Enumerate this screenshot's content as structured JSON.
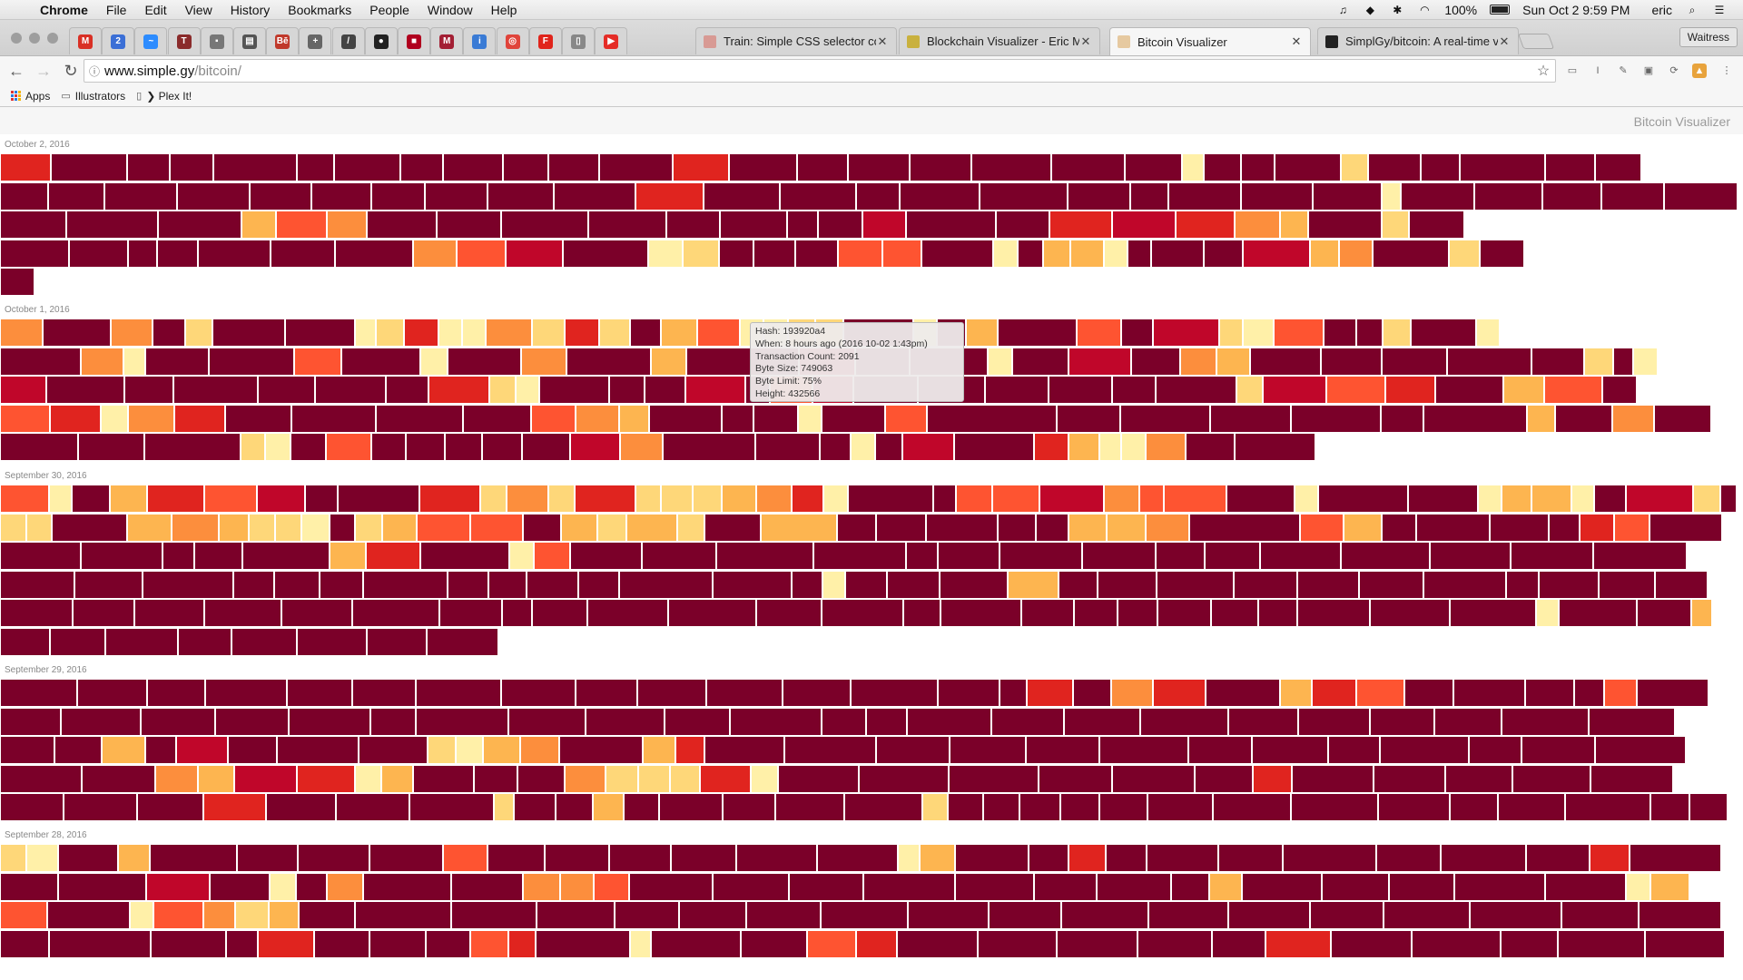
{
  "menubar": {
    "app": "Chrome",
    "items": [
      "File",
      "Edit",
      "View",
      "History",
      "Bookmarks",
      "People",
      "Window",
      "Help"
    ],
    "battery": "100%",
    "clock": "Sun Oct 2  9:59 PM",
    "user": "eric"
  },
  "tabs": {
    "pinned": [
      {
        "icon": "gmail-icon",
        "glyph": "M",
        "color": "#d93025"
      },
      {
        "icon": "calendar-icon",
        "glyph": "2",
        "color": "#3b6fd6"
      },
      {
        "icon": "messenger-icon",
        "glyph": "~",
        "color": "#2d8cff"
      },
      {
        "icon": "news-icon",
        "glyph": "T",
        "color": "#8a2b2b"
      },
      {
        "icon": "app-icon",
        "glyph": "▪",
        "color": "#777777"
      },
      {
        "icon": "reader-icon",
        "glyph": "▤",
        "color": "#555555"
      },
      {
        "icon": "behance-icon",
        "glyph": "Bē",
        "color": "#c0392b"
      },
      {
        "icon": "plus-icon",
        "glyph": "+",
        "color": "#666666"
      },
      {
        "icon": "chart-icon",
        "glyph": "/",
        "color": "#444444"
      },
      {
        "icon": "github-icon",
        "glyph": "●",
        "color": "#222222"
      },
      {
        "icon": "shield-icon",
        "glyph": "■",
        "color": "#b0001e"
      },
      {
        "icon": "mit-icon",
        "glyph": "M",
        "color": "#a31f34"
      },
      {
        "icon": "info-icon",
        "glyph": "i",
        "color": "#3a7bd5"
      },
      {
        "icon": "target-icon",
        "glyph": "◎",
        "color": "#e0443b"
      },
      {
        "icon": "font-icon",
        "glyph": "F",
        "color": "#e0241b"
      },
      {
        "icon": "doc-icon",
        "glyph": "▯",
        "color": "#888888"
      },
      {
        "icon": "youtube-icon",
        "glyph": "▶",
        "color": "#e52d27"
      }
    ],
    "open": [
      {
        "title": "Train: Simple CSS selector cor",
        "favicon": "#d89a94",
        "close": "✕"
      },
      {
        "title": "Blockchain Visualizer - Eric Mi",
        "favicon": "#c9b13e",
        "close": "✕"
      },
      {
        "title": "Bitcoin Visualizer",
        "favicon": "#e6c9a0",
        "close": "✕"
      },
      {
        "title": "SimplGy/bitcoin: A real-time vi",
        "favicon": "#222222",
        "close": "✕"
      }
    ],
    "active_index": 2,
    "profile": "Waitress"
  },
  "toolbar": {
    "url_host": "www.simple.gy",
    "url_path": "/bitcoin/"
  },
  "bookmarks": [
    {
      "label": "Apps",
      "icon": "apps-grid-icon"
    },
    {
      "label": "Illustrators",
      "icon": "folder-icon"
    },
    {
      "label": "❯ Plex It!",
      "icon": "page-icon"
    }
  ],
  "page": {
    "site_title": "Bitcoin Visualizer",
    "colors": {
      "C0": "#7b0029",
      "C1": "#c0062a",
      "C2": "#e0241f",
      "C3": "#fe5431",
      "C4": "#fc8e3d",
      "C5": "#fdb550",
      "C6": "#fed779",
      "C7": "#fff0a8"
    },
    "days": [
      {
        "label": "October 2, 2016",
        "rows": [
          "56:C2,84:C0,47:C0,48:C0,92:C0,41:C0,73:C0,47:C0,66:C0,50:C0,56:C0,81:C0,62:C2,75:C0,56:C0,68:C0,68:C0,88:C0,81:C0,63:C0,24:C7,41:C0,37:C0,73:C0,30:C6,58:C0,43:C0,94:C0,55:C0,51:C0",
          "53:C0,62:C0,80:C0,80:C0,68:C0,66:C0,59:C0,69:C0,73:C0,90:C0,75:C2,84:C0,84:C0,48:C0,88:C0,97:C0,69:C0,42:C0,80:C0,79:C0,76:C0,21:C7,81:C0,75:C0,65:C0,69:C0,81:C0,56:C0,51:C0,80:C0",
          "73:C0,101:C0,92:C0,38:C5,56:C3,44:C4,77:C0,71:C0,96:C0,86:C0,59:C0,74:C0,34:C0,49:C0,48:C1,99:C0,59:C0,69:C2,70:C1,65:C2,50:C4,31:C5,81:C0,30:C6,61:C0",
          "76:C0,65:C0,32:C0,45:C0,80:C0,71:C0,86:C0,48:C4,54:C3,63:C1,94:C0,38:C7,40:C6,38:C0,46:C0,47:C0,49:C3,43:C3,79:C0,27:C7,28:C0,30:C5,37:C5,26:C7,26:C0,58:C0,43:C0,74:C1,32:C5,37:C4,84:C0,34:C6,49:C0",
          "38:C0"
        ]
      },
      {
        "label": "October 1, 2016",
        "rows": [
          "47:C4,75:C0,46:C4,36:C0,30:C6,80:C0,77:C0,23:C7,31:C6,38:C2,26:C7,26:C7,51:C4,36:C6,38:C2,34:C6,34:C0,40:C5,47:C3,26:C7,27:C7,30:C6,31:C6,77:C0,26:C7,32:C0,35:C5,87:C0,49:C3,35:C0,73:C1,26:C6,34:C7,55:C3,36:C0,29:C0,31:C6,72:C0,26:C7",
          "89:C0,47:C4,24:C7,70:C0,94:C0,52:C3,87:C0,30:C7,81:C0,50:C4,93:C0,39:C5,124:C0,62:C1,60:C0,86:C0,27:C7,62:C0,69:C1,54:C0,40:C4,37:C5,78:C0,67:C0,72:C0,93:C0,58:C0,32:C6,22:C0,27:C7",
          "51:C1,86:C0,54:C0,93:C0,63:C0,78:C0,47:C0,67:C2,29:C6,26:C7,77:C0,39:C0,45:C0,66:C1,27:C0,47:C3,45:C1,71:C0,74:C0,70:C0,70:C0,48:C0,89:C0,29:C6,70:C1,65:C3,55:C2,75:C0,45:C5,64:C3,38:C0",
          "55:C3,56:C2,30:C7,51:C4,56:C2,73:C0,93:C0,96:C0,75:C0,49:C3,48:C4,33:C5,80:C0,35:C0,49:C0,26:C7,70:C0,46:C3,143:C0,70:C0,99:C0,89:C0,99:C0,47:C0,114:C0,31:C5,63:C0,46:C4,63:C0,80:C0",
          "86:C0,73:C0,106:C0,27:C6,28:C7,39:C0,50:C3,38:C0,43:C0,41:C0,44:C0,53:C0,55:C1,47:C4,102:C0,71:C0,34:C0,27:C7,30:C0,57:C1,88:C0,38:C2,34:C5,24:C7,27:C7,44:C4,54:C0,89:C0"
        ]
      },
      {
        "label": "September 30, 2016",
        "rows": [
          "54:C3,25:C7,42:C0,41:C5,63:C2,58:C3,53:C1,36:C0,90:C0,67:C2,29:C6,46:C4,29:C6,67:C2,28:C6,35:C6,32:C6,38:C5,39:C4,35:C2,27:C7,94:C0,25:C0,40:C3,52:C3,71:C1,39:C4,27:C3,69:C3,75:C0,26:C7,99:C0,77:C0,26:C7,33:C5,44:C5,25:C7,35:C0,74:C1,30:C6,44:C0,26:C7,29:C4,31:C0,18:C0,58:C0,25:C7",
          "29:C6,28:C6,83:C0,49:C5,52:C4,33:C5,29:C6,29:C6,31:C7,28:C0,30:C6,38:C5,59:C3,58:C3,42:C0,40:C5,32:C6,56:C5,30:C6,62:C0,84:C5,43:C0,55:C0,79:C0,42:C0,36:C0,42:C5,43:C5,48:C4,122:C0,48:C3,42:C5,38:C0,81:C0,65:C0,34:C0,38:C2,39:C3,80:C0",
          "89:C0,90:C0,35:C0,53:C0,96:C0,40:C5,60:C2,98:C0,27:C7,40:C3,79:C0,82:C0,107:C0,102:C0,35:C0,68:C0,91:C0,81:C0,54:C0,61:C0,89:C0,98:C0,89:C0,91:C0,103:C0,87:C0,79:C0,67:C0,79:C0",
          "82:C0,75:C0,100:C0,45:C0,50:C0,48:C0,93:C0,45:C0,42:C0,57:C0,45:C0,103:C0,87:C0,34:C0,25:C7,46:C0,58:C0,75:C0,56:C5,43:C0,65:C0,85:C0,70:C0,68:C0,71:C0,91:C0,36:C0,66:C0,62:C0,58:C0,61:C0,57:C0,57:C0,57:C0,86:C0,93:C0",
          "80:C0,68:C0,77:C0,85:C0,78:C0,96:C0,69:C0,33:C0,61:C0,89:C0,97:C0,72:C0,90:C0,41:C0,89:C0,58:C0,48:C0,44:C0,59:C0,52:C0,43:C0,80:C0,88:C0,95:C0,25:C7,86:C0,60:C0,77:C1,23:C5,46:C0,48:C0,72:C0,70:C0,46:C0,92:C0,76:C0,84:C0,76:C0",
          "55:C0,61:C0,80:C0,59:C0,72:C0,77:C0,66:C0,79:C0"
        ]
      },
      {
        "label": "September 29, 2016",
        "rows": [
          "85:C0,77:C0,64:C0,90:C0,72:C0,70:C0,94:C0,82:C0,68:C0,76:C0,84:C0,75:C0,96:C0,68:C0,30:C0,51:C2,42:C0,46:C4,58:C2,82:C0,35:C5,49:C2,53:C3,54:C0,79:C0,54:C0,33:C0,36:C3,79:C0,87:C0,86:C0,89:C0,86:C0,92:C0",
          "67:C0,88:C0,82:C0,81:C0,90:C0,50:C0,102:C0,85:C0,87:C0,72:C0,101:C0,49:C0,45:C0,93:C0,80:C0,84:C0,97:C0,77:C0,79:C0,71:C0,74:C0,96:C0,95:C0,78:C0,80:C0,77:C0,83:C0,80:C0,89:C0",
          "60:C0,52:C0,48:C5,34:C0,57:C1,54:C0,90:C0,76:C0,31:C6,30:C7,41:C5,43:C4,92:C0,36:C5,32:C2,88:C0,101:C0,81:C0,84:C0,81:C0,98:C0,70:C0,84:C0,57:C0,98:C0,58:C0,81:C0,100:C0,99:C0,97:C0",
          "90:C0,81:C0,47:C4,40:C5,69:C1,64:C2,29:C7,35:C5,67:C0,48:C0,52:C0,45:C4,36:C6,35:C6,33:C6,56:C2,30:C7,89:C0,99:C0,99:C0,81:C0,91:C0,64:C0,43:C2,90:C0,79:C0,74:C0,86:C0,91:C0,82:C0",
          "70:C0,81:C0,73:C0,69:C2,77:C0,81:C0,93:C0,22:C6,46:C0,41:C0,34:C5,39:C0,70:C0,58:C0,76:C0,86:C0,28:C6,39:C0,40:C0,45:C0,43:C0,53:C0,72:C0,86:C0,96:C0,79:C0,53:C0,74:C0,94:C0,43:C0,42:C0,30:C0,52:C0,25:C6,27:C6,69:C0,79:C0,73:C0,70:C1"
        ]
      },
      {
        "label": "September 28, 2016",
        "rows": [
          "29:C6,35:C7,66:C0,35:C5,96:C0,67:C0,79:C0,81:C0,49:C3,63:C0,71:C0,68:C0,72:C0,89:C0,89:C0,24:C7,39:C5,81:C0,44:C0,41:C2,45:C0,79:C0,71:C0,103:C0,71:C0,94:C0,70:C0,44:C2,101:C0,54:C0,73:C0,86:C0,63:C0,79:C0,45:C1",
          "64:C0,97:C0,70:C1,66:C0,29:C7,34:C0,40:C4,97:C0,79:C0,41:C4,37:C4,39:C3,92:C0,84:C0,82:C0,101:C0,87:C0,69:C0,82:C0,42:C0,36:C5,88:C0,74:C0,72:C0,100:C0,89:C0,27:C7,43:C5",
          "52:C3,91:C0,26:C7,55:C3,35:C4,37:C6,33:C5,62:C0,106:C0,94:C0,86:C0,71:C0,74:C0,82:C0,96:C0,89:C0,80:C0,96:C0,88:C0,90:C0,81:C0,95:C0,101:C0,85:C0,91:C0,89:C0,90:C0",
          "54:C0,112:C0,83:C0,35:C0,62:C2,61:C0,62:C0,49:C0,42:C3,30:C2,104:C0,23:C7,99:C0,73:C0,54:C3,45:C2,89:C0,87:C0,89:C0,82:C0,59:C0,72:C2,89:C0,98:C0,63:C0,96:C0,88:C0,85:C0,92:C0,55:C0,51:C0,45:C0"
        ]
      }
    ],
    "tooltip": {
      "hash": "Hash: 193920a4",
      "when": "When: 8 hours ago (2016 10-02 1:43pm)",
      "tx_count": "Transaction Count: 2091",
      "byte_size": "Byte Size: 749063",
      "byte_limit": "Byte Limit: 75%",
      "height": "Height: 432566"
    }
  }
}
